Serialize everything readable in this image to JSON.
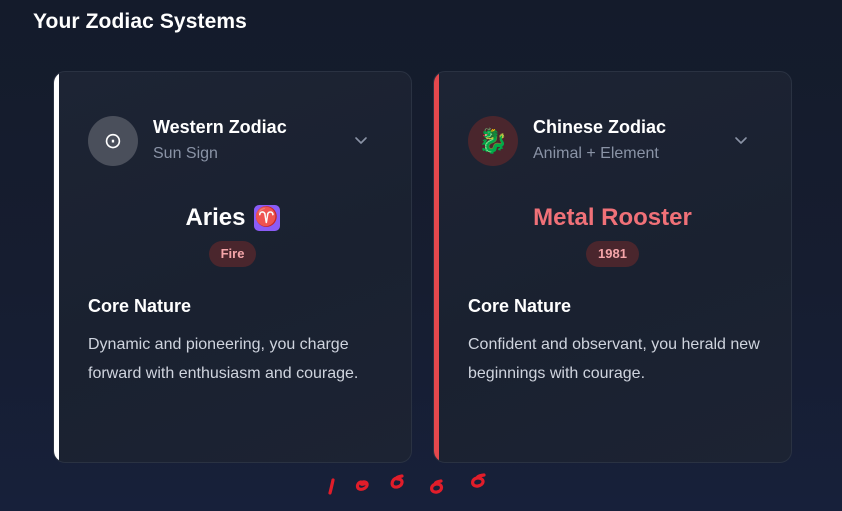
{
  "section": {
    "title": "Your Zodiac Systems"
  },
  "cards": [
    {
      "name": "Western Zodiac",
      "subtitle": "Sun Sign",
      "avatar_icon": "sun-icon",
      "avatar_glyph": "⊙",
      "sign": "Aries",
      "sign_symbol": "♈",
      "badge": "Fire",
      "core_title": "Core Nature",
      "core_text": "Dynamic and pioneering, you charge forward with enthusiasm and courage.",
      "accent_color": "#ffffff"
    },
    {
      "name": "Chinese Zodiac",
      "subtitle": "Animal + Element",
      "avatar_icon": "dragon-icon",
      "avatar_glyph": "🐉",
      "sign": "Metal Rooster",
      "badge": "1981",
      "core_title": "Core Nature",
      "core_text": "Confident and observant, you herald new beginnings with courage.",
      "accent_color": "#e5484d"
    }
  ],
  "colors": {
    "background": "#161d30",
    "card_background": "#1d2434",
    "chinese_sign": "#f07178",
    "badge_bg": "#4a262d",
    "badge_text": "#f4a5a9",
    "scribble": "#e11d2a"
  }
}
